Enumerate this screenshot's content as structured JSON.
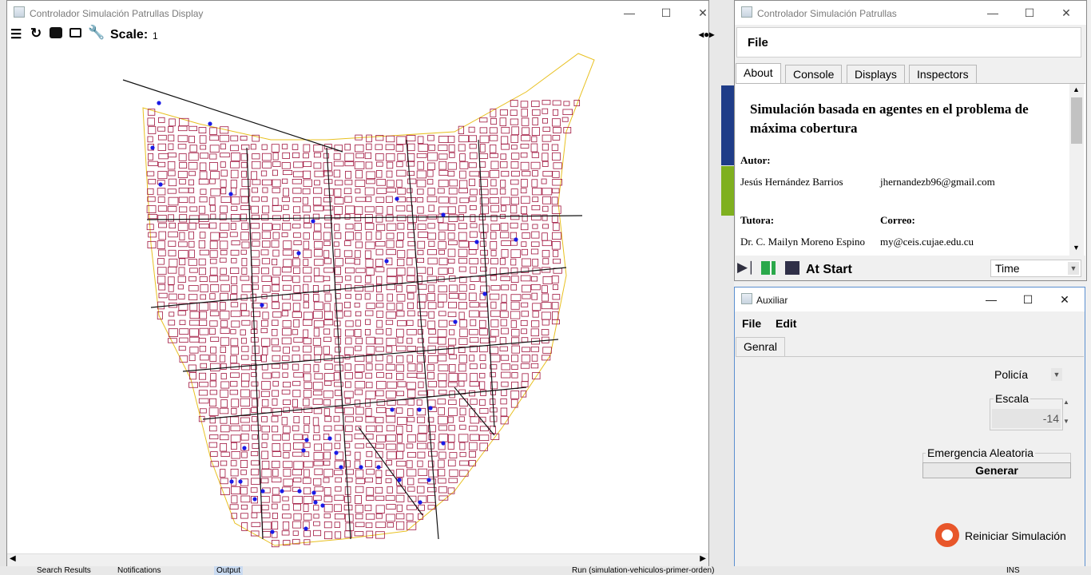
{
  "display_window": {
    "title": "Controlador Simulación Patrullas Display",
    "scale_label": "Scale:",
    "scale_value": "1",
    "tools": [
      "list-icon",
      "refresh-icon",
      "camera-movie-icon",
      "camera-icon",
      "wrench-icon"
    ]
  },
  "controller_window": {
    "title": "Controlador Simulación Patrullas",
    "menu_file": "File",
    "tabs": [
      "About",
      "Console",
      "Displays",
      "Inspectors"
    ],
    "selected_tab": "About",
    "about": {
      "heading": "Simulación basada en agentes en el problema de máxima cobertura",
      "author_label": "Autor:",
      "author_name": "Jesús Hernández Barrios",
      "author_email": "jhernandezb96@gmail.com",
      "tutor_label": "Tutora:",
      "mail_label": "Correo:",
      "tutor_name": "Dr. C. Mailyn Moreno Espino",
      "tutor_email": "my@ceis.cujae.edu.cu"
    },
    "status": "At Start",
    "time_combo": "Time"
  },
  "aux_window": {
    "title": "Auxiliar",
    "menu_file": "File",
    "menu_edit": "Edit",
    "tab": "Genral",
    "agent_combo": "Policía",
    "scale_group": "Escala",
    "scale_value": "-14",
    "emergency_group": "Emergencia Aleatoria",
    "generate_button": "Generar",
    "reset_button": "Reiniciar Simulación"
  },
  "taskbar": {
    "search_results": "Search Results",
    "notifications": "Notifications",
    "output": "Output",
    "run_status": "Run (simulation-vehiculos-primer-orden)",
    "ins": "INS"
  },
  "colors": {
    "map_blocks": "#a0153e",
    "map_streets": "#111111",
    "map_border": "#e8c020",
    "agents": "#1a1ae6",
    "play_green": "#2aa84a"
  }
}
